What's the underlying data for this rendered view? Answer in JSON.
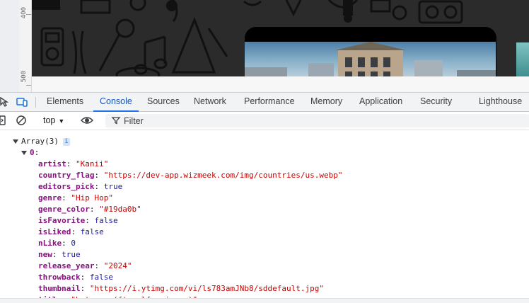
{
  "ruler": {
    "marks": [
      "400",
      "500"
    ]
  },
  "devtools": {
    "tabs": [
      {
        "label": "Elements",
        "active": false
      },
      {
        "label": "Console",
        "active": true
      },
      {
        "label": "Sources",
        "active": false
      },
      {
        "label": "Network",
        "active": false
      },
      {
        "label": "Performance",
        "active": false
      },
      {
        "label": "Memory",
        "active": false
      },
      {
        "label": "Application",
        "active": false
      },
      {
        "label": "Security",
        "active": false
      },
      {
        "label": "Lighthouse",
        "active": false
      }
    ],
    "accent": "#1a73e8"
  },
  "toolbar": {
    "context": "top",
    "filter_placeholder": "Filter"
  },
  "console": {
    "array_label": "Array(3)",
    "info_badge": "i",
    "index_label": "0",
    "props": [
      {
        "key": "artist",
        "value": "\"Kanii\"",
        "kind": "string"
      },
      {
        "key": "country_flag",
        "value": "\"https://dev-app.wizmeek.com/img/countries/us.webp\"",
        "kind": "string"
      },
      {
        "key": "editors_pick",
        "value": "true",
        "kind": "literal"
      },
      {
        "key": "genre",
        "value": "\"Hip Hop\"",
        "kind": "string"
      },
      {
        "key": "genre_color",
        "value": "\"#19da0b\"",
        "kind": "string"
      },
      {
        "key": "isFavorite",
        "value": "false",
        "kind": "literal"
      },
      {
        "key": "isLiked",
        "value": "false",
        "kind": "literal"
      },
      {
        "key": "nLike",
        "value": "0",
        "kind": "literal"
      },
      {
        "key": "new",
        "value": "true",
        "kind": "literal"
      },
      {
        "key": "release_year",
        "value": "\"2024\"",
        "kind": "string"
      },
      {
        "key": "throwback",
        "value": "false",
        "kind": "literal"
      },
      {
        "key": "thumbnail",
        "value": "\"https://i.ytimg.com/vi/ls783amJNb8/sddefault.jpg\"",
        "kind": "string"
      },
      {
        "key": "title",
        "value": "\"hate me (ft wolfacejoeyy)\"",
        "kind": "string"
      }
    ]
  }
}
